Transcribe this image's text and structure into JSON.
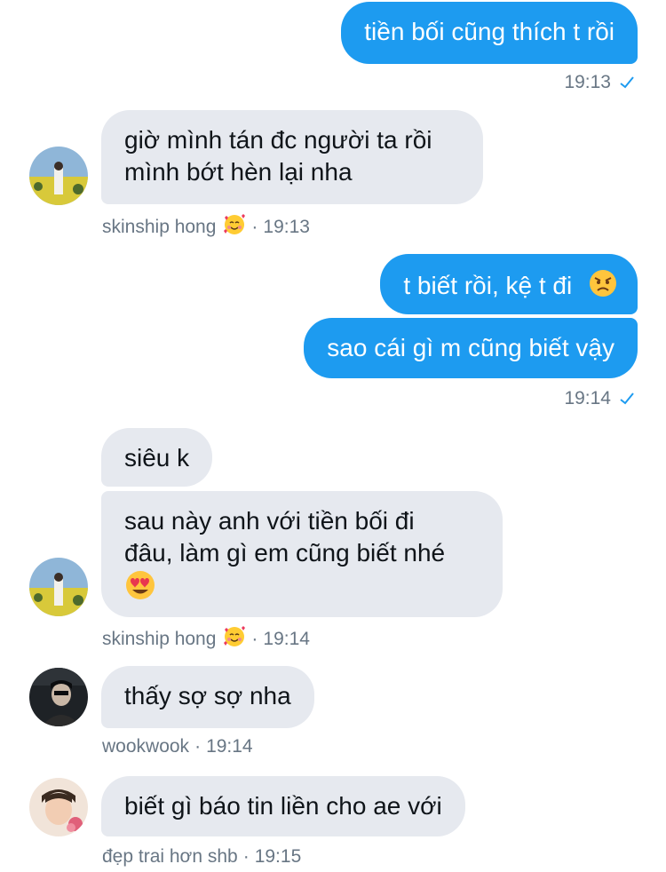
{
  "messages": {
    "m1": {
      "text": "tiền bối cũng thích t rồi",
      "time": "19:13"
    },
    "m2": {
      "line1": "giờ mình tán đc người ta rồi",
      "line2": "mình bớt hèn lại nha",
      "sender": "skinship hong",
      "time": "19:13"
    },
    "m3": {
      "text": "t biết rồi, kệ t đi"
    },
    "m4": {
      "text": "sao cái gì m cũng biết vậy",
      "time": "19:14"
    },
    "m5": {
      "text": "siêu k"
    },
    "m6": {
      "line1": "sau này anh với tiền bối đi",
      "line2": "đâu, làm gì em cũng biết nhé",
      "sender": "skinship hong",
      "time": "19:14"
    },
    "m7": {
      "text": "thấy sợ sợ nha",
      "sender": "wookwook",
      "time": "19:14"
    },
    "m8": {
      "text": "biết gì báo tin liền cho ae với",
      "sender": "đẹp trai hơn shb",
      "time": "19:15"
    }
  },
  "symbols": {
    "dot": "·"
  },
  "icons": {
    "read_receipt": "check-icon",
    "emoji_smiling_hearts": "smiling-face-with-hearts",
    "emoji_angry": "angry-face",
    "emoji_heart_eyes": "heart-eyes-face"
  },
  "colors": {
    "outgoing_bubble": "#1d9bf0",
    "incoming_bubble": "#e6e9ef",
    "meta_text": "#687684",
    "text_dark": "#0f1419"
  }
}
